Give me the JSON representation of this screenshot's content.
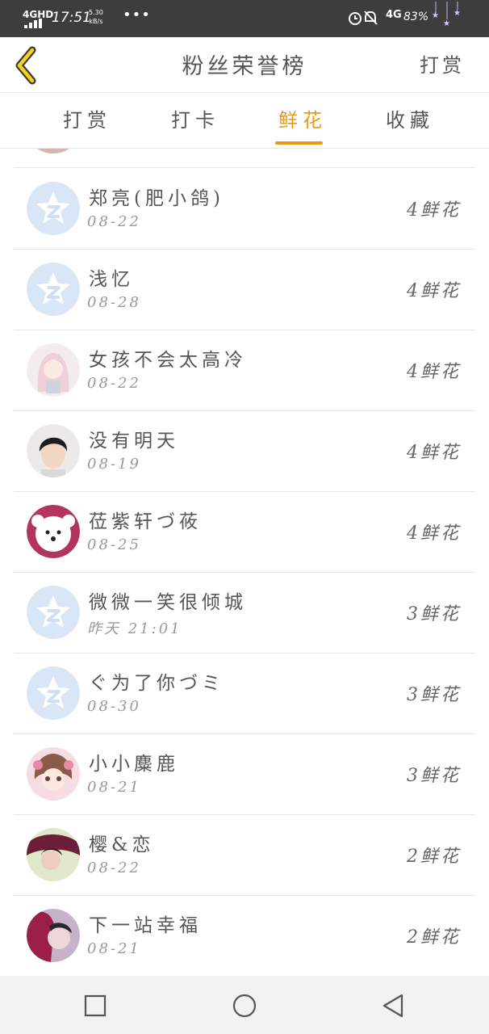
{
  "status_bar": {
    "network": "4GHD",
    "time": "17:51",
    "speed": "5.30",
    "speed_unit": "kB/s",
    "more": "•••",
    "network2": "4G",
    "battery": "83%"
  },
  "header": {
    "back_icon": "chevron-left-icon",
    "title": "粉丝荣誉榜",
    "action": "打赏"
  },
  "tabs": [
    {
      "label": "打赏",
      "active": false
    },
    {
      "label": "打卡",
      "active": false
    },
    {
      "label": "鲜花",
      "active": true
    },
    {
      "label": "收藏",
      "active": false
    }
  ],
  "accent_color": "#e89a17",
  "fans": [
    {
      "name": "郑亮(肥小鸽)",
      "date": "08-22",
      "count": "4鲜花",
      "avatar": "default-qzone-avatar"
    },
    {
      "name": "浅忆",
      "date": "08-28",
      "count": "4鲜花",
      "avatar": "default-qzone-avatar"
    },
    {
      "name": "女孩不会太高冷",
      "date": "08-22",
      "count": "4鲜花",
      "avatar": "anime-girl-avatar"
    },
    {
      "name": "没有明天",
      "date": "08-19",
      "count": "4鲜花",
      "avatar": "boy-photo-avatar"
    },
    {
      "name": "莅紫轩づ莜",
      "date": "08-25",
      "count": "4鲜花",
      "avatar": "white-plush-avatar"
    },
    {
      "name": "微微一笑很倾城",
      "date": "昨天 21:01",
      "count": "3鲜花",
      "avatar": "default-qzone-avatar"
    },
    {
      "name": "ぐ为了你づミ",
      "date": "08-30",
      "count": "3鲜花",
      "avatar": "default-qzone-avatar"
    },
    {
      "name": "小小麋鹿",
      "date": "08-21",
      "count": "3鲜花",
      "avatar": "anime-pink-girl-avatar"
    },
    {
      "name": "樱&恋",
      "date": "08-22",
      "count": "2鲜花",
      "avatar": "girl-photo-avatar"
    },
    {
      "name": "下一站幸福",
      "date": "08-21",
      "count": "2鲜花",
      "avatar": "couple-photo-avatar"
    }
  ],
  "nav": {
    "recents_icon": "square-icon",
    "home_icon": "circle-icon",
    "back_icon": "triangle-back-icon"
  }
}
